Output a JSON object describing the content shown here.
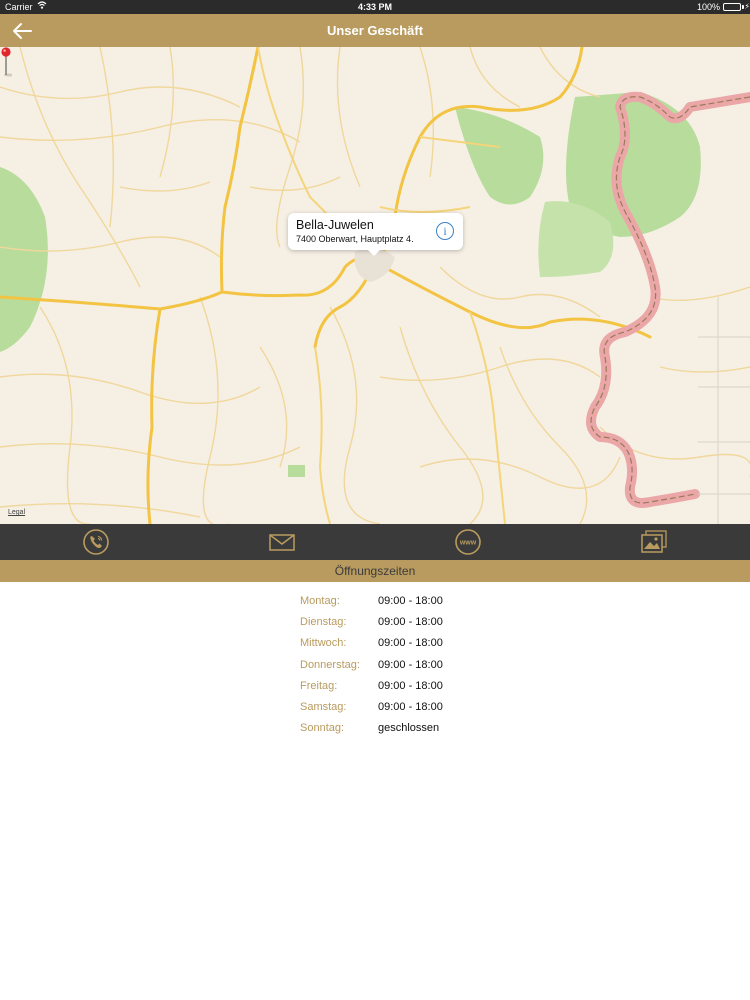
{
  "status_bar": {
    "carrier": "Carrier",
    "time": "4:33 PM",
    "battery": "100%",
    "battery_level": 1.0
  },
  "nav": {
    "title": "Unser Geschäft",
    "back_icon": "arrow-left-icon"
  },
  "map": {
    "callout": {
      "name": "Bella-Juwelen",
      "address": "7400 Oberwart, Hauptplatz 4.",
      "info_icon": "info-icon"
    },
    "legal": "Legal",
    "colors": {
      "land": "#f6efe4",
      "forest": "#b7dc9c",
      "major_road": "#f3c342",
      "minor_road": "#f0d79b",
      "border": "#e7a3a3"
    }
  },
  "toolbar": {
    "items": [
      {
        "icon": "phone-icon"
      },
      {
        "icon": "mail-icon"
      },
      {
        "icon": "www-icon"
      },
      {
        "icon": "gallery-icon"
      }
    ]
  },
  "opening_hours": {
    "title": "Öffnungszeiten",
    "rows": [
      {
        "day": "Montag:",
        "time": "09:00 - 18:00"
      },
      {
        "day": "Dienstag:",
        "time": "09:00 - 18:00"
      },
      {
        "day": "Mittwoch:",
        "time": "09:00 - 18:00"
      },
      {
        "day": "Donnerstag:",
        "time": "09:00 - 18:00"
      },
      {
        "day": "Freitag:",
        "time": "09:00 - 18:00"
      },
      {
        "day": "Samstag:",
        "time": "09:00 - 18:00"
      },
      {
        "day": "Sonntag:",
        "time": "geschlossen"
      }
    ]
  },
  "colors": {
    "accent": "#b99b5f",
    "toolbar_bg": "#3a3a3a",
    "status_bg": "#2b2b2b"
  }
}
